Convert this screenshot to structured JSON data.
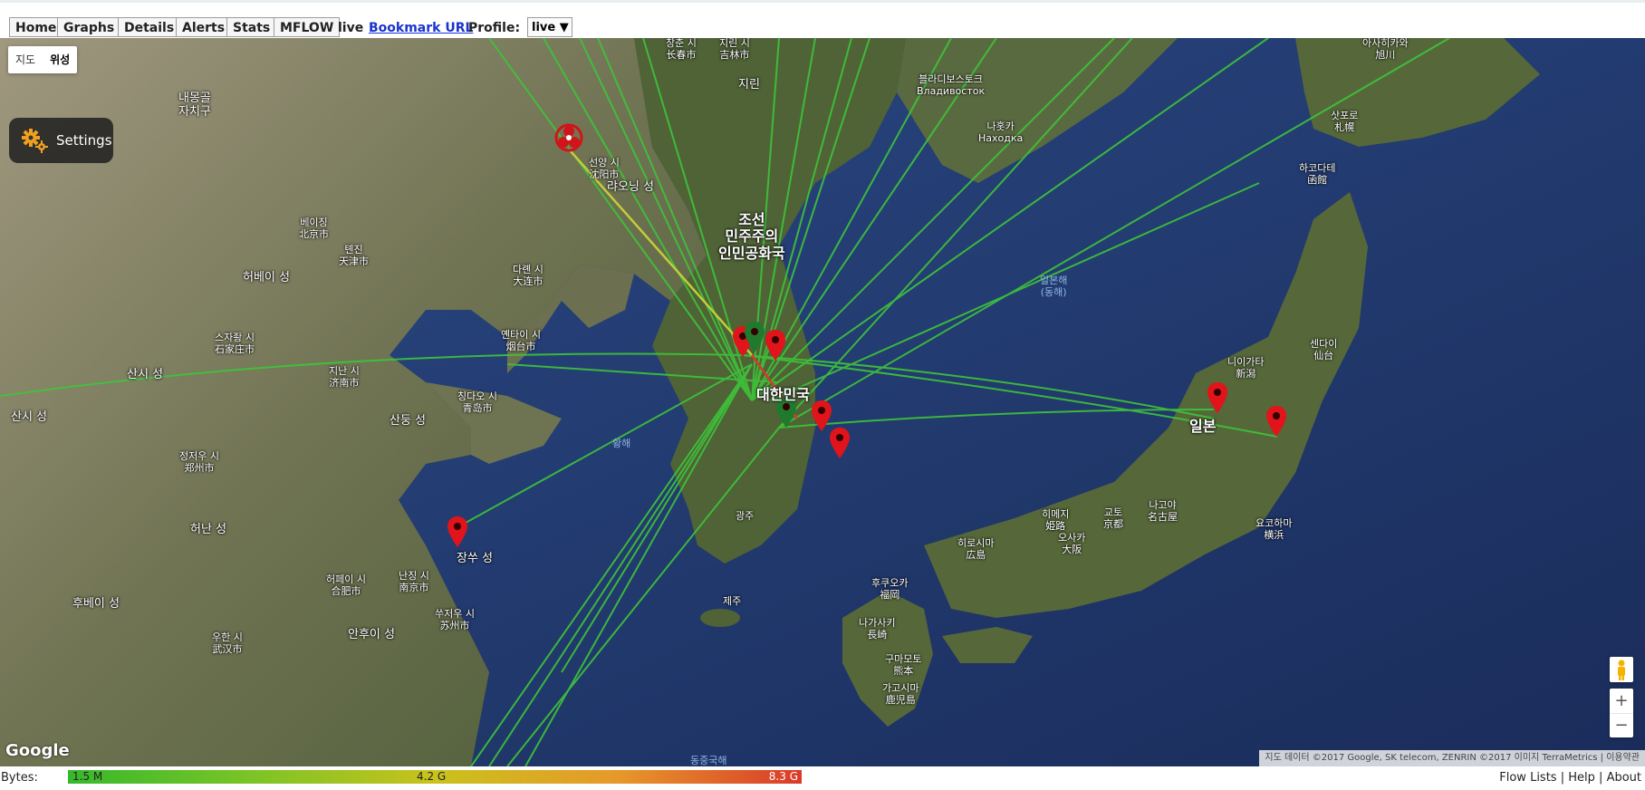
{
  "nav": {
    "home": "Home",
    "graphs": "Graphs",
    "details": "Details",
    "alerts": "Alerts",
    "stats": "Stats",
    "mflow": "MFLOW",
    "live_text": "live",
    "bookmark": "Bookmark URL",
    "profile_label": "Profile:",
    "profile_value": "live ▼"
  },
  "map": {
    "type_buttons": [
      "지도",
      "위성"
    ],
    "selected_type": "위성",
    "settings_label": "Settings",
    "google": "Google",
    "attribution": "지도 데이터 ©2017 Google, SK telecom, ZENRIN ©2017 이미지 TerraMetrics | 이용약관",
    "zoom_in": "+",
    "zoom_out": "−",
    "labels": {
      "korea_n": "조선\n민주주의\n인민공화국",
      "korea_s": "대한민국",
      "japan": "일본",
      "jilin": "지린",
      "liaoning": "랴오닝 성",
      "hebei": "허베이 성",
      "shanxi": "산시 성",
      "shandong": "산둥 성",
      "henan": "허난 성",
      "jiangsu": "장쑤 성",
      "hubei": "후베이 성",
      "anhui": "안후이 성",
      "innermongolia": "내몽골\n자치구",
      "shaanxi": "산시 성",
      "beijing": "베이징\n北京市",
      "tianjin": "톈진\n天津市",
      "dalian": "다롄 시\n大连市",
      "shenyang": "선양 시\n沈阳市",
      "yantai": "옌타이 시\n烟台市",
      "qingdao": "칭다오 시\n青岛市",
      "jinan": "지난 시\n济南市",
      "shijiazhuang": "스자좡 시\n石家庄市",
      "nanjing": "난징 시\n南京市",
      "hefei": "허페이 시\n合肥市",
      "wuhan": "우한 시\n武汉市",
      "zhengzhou": "정저우 시\n郑州市",
      "suzhou": "쑤저우 시\n苏州市",
      "vladivostok": "블라디보스토크\nВладивосток",
      "nakhodka": "나홋카\nНаходка",
      "changchun": "창춘 시\n长春市",
      "jilin_city": "지린 시\n吉林市",
      "gwangju": "광주",
      "jeju": "제주",
      "fukuoka": "후쿠오카\n福岡",
      "hiroshima": "히로시마\n広島",
      "osaka": "오사카\n大阪",
      "kyoto": "교토\n京都",
      "nagoya": "나고야\n名古屋",
      "yokohama": "요코하마\n横浜",
      "niigata": "니이가타\n新潟",
      "sendai": "센다이\n仙台",
      "sapporo": "삿포로\n札幌",
      "hakodate": "하코다테\n函館",
      "asahikawa": "아사히카와\n旭川",
      "kumamoto": "구마모토\n熊本",
      "kagoshima": "가고시마\n鹿児島",
      "nagasaki": "나가사키\n長崎",
      "himeji": "히메지\n姫路",
      "sea_east": "일본해\n(동해)",
      "sea_yellow": "황해",
      "sea_east_china": "동중국해"
    }
  },
  "legend": {
    "bytes_label": "Bytes:",
    "min": "1.5 M",
    "mid": "4.2 G",
    "max": "8.3 G"
  },
  "footer": {
    "flow_lists": "Flow Lists",
    "help": "Help",
    "about": "About",
    "sep": "|"
  },
  "colors": {
    "flow_line": "#3ec43a",
    "flow_line_alert": "#c4cc3a",
    "marker_red": "#e0141a",
    "marker_green": "#1f7a2e"
  }
}
